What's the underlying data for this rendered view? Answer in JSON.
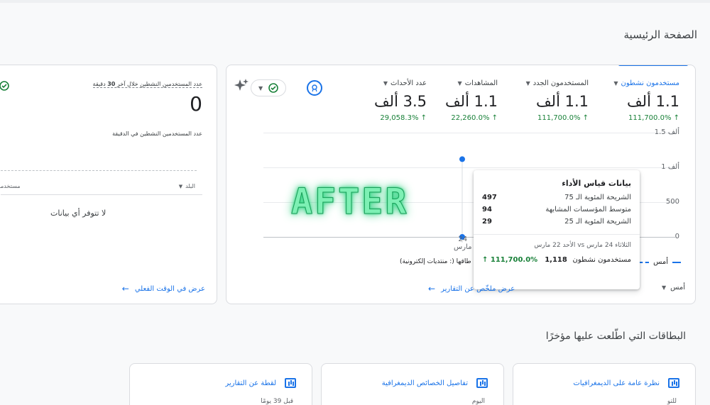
{
  "page": {
    "title": "الصفحة الرئيسية"
  },
  "metrics": [
    {
      "label": "مستخدمون نشطون",
      "value": "1.1 ألف",
      "change": "111,700.0% ↑"
    },
    {
      "label": "المستخدمون الجدد",
      "value": "1.1 ألف",
      "change": "111,700.0% ↑"
    },
    {
      "label": "المشاهدات",
      "value": "1.1 ألف",
      "change": "22,260.0% ↑"
    },
    {
      "label": "عدد الأحداث",
      "value": "3.5 ألف",
      "change": "29,058.3% ↑"
    }
  ],
  "chart_data": {
    "type": "line",
    "yticks": [
      "1.5 ألف",
      "1 ألف",
      "500",
      "0"
    ],
    "xtick_day": "24",
    "xtick_month": "مارس",
    "values": [
      1118,
      0
    ],
    "ylim": [
      0,
      1500
    ]
  },
  "tooltip": {
    "title": "بيانات قياس الأداء",
    "rows": [
      {
        "label": "الشريحة المئوية الـ 75",
        "value": "497"
      },
      {
        "label": "متوسط المؤسسات المشابهة",
        "value": "94"
      },
      {
        "label": "الشريحة المئوية الـ 25",
        "value": "29"
      }
    ],
    "date_range": "الثلاثاء 24 مارس vs الأحد 22 مارس",
    "footer_label": "مستخدمون نشطون",
    "footer_value": "1,118",
    "footer_change": "↑ 111,700.0%"
  },
  "legend": {
    "series_label": "أمس"
  },
  "watermark": "AFTER",
  "main_card": {
    "peer_note": "طاقها (: منتديات إلكترونية)",
    "date_selector": "أمس",
    "reports_link": "عرض ملخّص عن التقارير"
  },
  "realtime": {
    "active_label_prefix": "عدد المستخدمين النشطين خلال آخر",
    "active_minutes": "30",
    "active_label_suffix": "دقيقة",
    "active_value": "0",
    "per_minute_label": "عدد المستخدمين النشطين في الدقيقة",
    "country_col": "البلد",
    "users_col": "مستخدمون",
    "no_data": "لا تتوفر أي بيانات",
    "link": "عرض في الوقت الفعلي"
  },
  "recent": {
    "title": "البطاقات التي اطّلعت عليها مؤخرًا",
    "cards": [
      {
        "title": "نظرة عامة على الديمغرافيات",
        "sub": "للتو"
      },
      {
        "title": "تفاصيل الخصائص الديمغرافية",
        "sub": "اليوم"
      },
      {
        "title": "لقطة عن التقارير",
        "sub": "قبل 39 يومًا"
      }
    ]
  },
  "colors": {
    "accent": "#1a73e8",
    "positive": "#188038"
  }
}
